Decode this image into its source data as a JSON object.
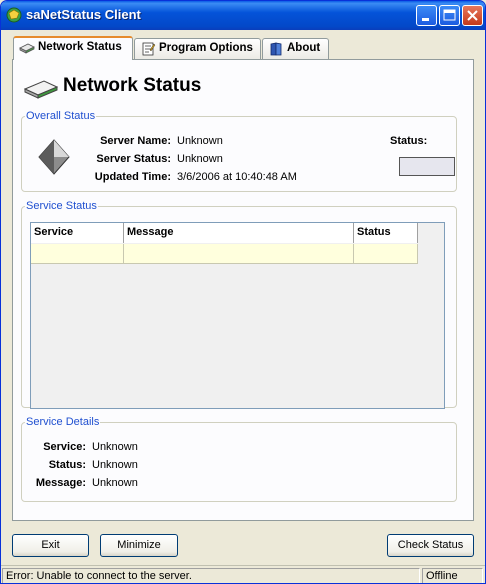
{
  "window": {
    "title": "saNetStatus Client"
  },
  "tabs": [
    {
      "label": "Network Status",
      "icon": "drive-icon",
      "active": true
    },
    {
      "label": "Program Options",
      "icon": "notepad-icon",
      "active": false
    },
    {
      "label": "About",
      "icon": "book-icon",
      "active": false
    }
  ],
  "page": {
    "heading": "Network Status"
  },
  "overall": {
    "legend": "Overall Status",
    "server_name_label": "Server Name:",
    "server_name": "Unknown",
    "server_status_label": "Server Status:",
    "server_status": "Unknown",
    "updated_label": "Updated Time:",
    "updated": "3/6/2006 at 10:40:48 AM",
    "status_label": "Status:"
  },
  "service_status": {
    "legend": "Service Status",
    "columns": [
      "Service",
      "Message",
      "Status"
    ],
    "rows": [
      [
        "",
        "",
        ""
      ]
    ]
  },
  "details": {
    "legend": "Service Details",
    "service_label": "Service:",
    "service": "Unknown",
    "status_label": "Status:",
    "status": "Unknown",
    "message_label": "Message:",
    "message": "Unknown"
  },
  "buttons": {
    "exit": "Exit",
    "minimize": "Minimize",
    "check_status": "Check Status"
  },
  "statusbar": {
    "message": "Error: Unable to connect to the server.",
    "state": "Offline"
  },
  "colors": {
    "titlebar": "#0453d9",
    "group_legend": "#2050d0",
    "row_highlight": "#ffffdd",
    "active_tab_accent": "#e68b2c"
  }
}
